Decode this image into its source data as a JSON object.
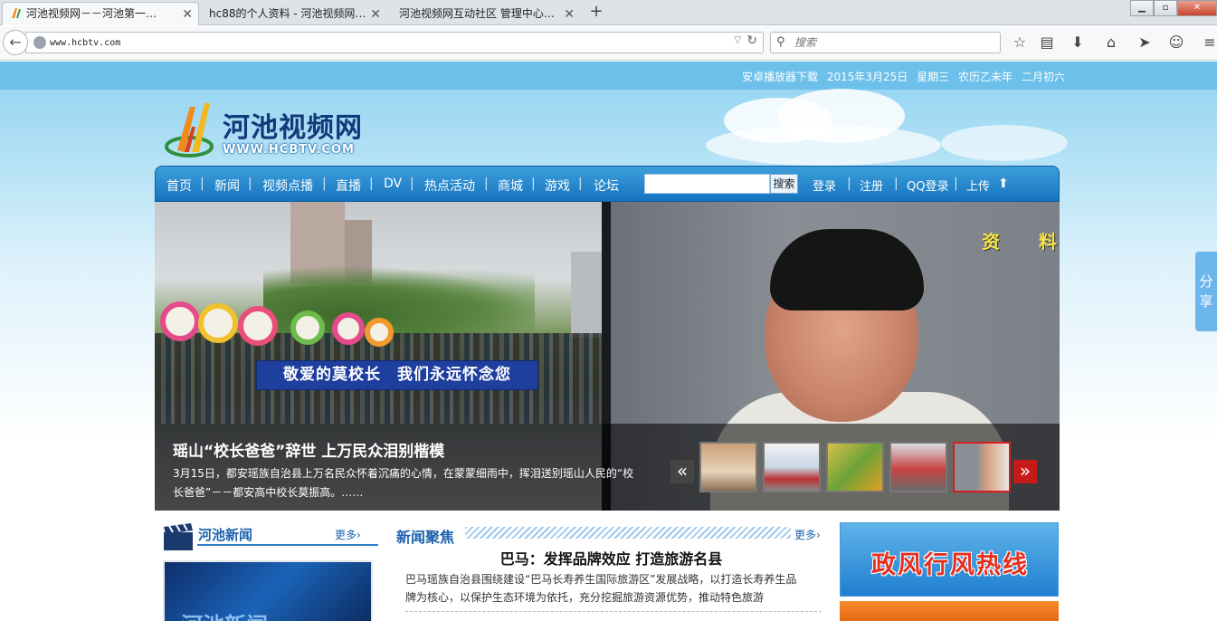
{
  "browser": {
    "tabs": [
      {
        "title": "河池视频网－－河池第一…",
        "active": true
      },
      {
        "title": "hc88的个人资料 - 河池视频网…",
        "active": false
      },
      {
        "title": "河池视频网互动社区 管理中心…",
        "active": false
      }
    ],
    "new_tab": "+",
    "url": "www.hcbtv.com",
    "search_placeholder": "搜索",
    "toolbar_icons": [
      "star-icon",
      "reading-list-icon",
      "download-icon",
      "home-icon",
      "send-icon",
      "chat-icon",
      "menu-icon"
    ]
  },
  "header": {
    "topbar_items": [
      "安卓播放器下载",
      "2015年3月25日",
      "星期三",
      "农历乙未年",
      "二月初六"
    ],
    "logo_text": "河池视频网",
    "logo_url_text": "WWW.HCBTV.COM"
  },
  "nav": {
    "items": [
      "首页",
      "新闻",
      "视频点播",
      "直播",
      "DV",
      "热点活动",
      "商城",
      "游戏",
      "论坛"
    ],
    "search_button": "搜索",
    "user_links": [
      "登录",
      "注册",
      "QQ登录",
      "上传"
    ]
  },
  "slider": {
    "banner_text": "敬爱的莫校长　我们永远怀念您",
    "overlay_text": "资 料",
    "title": "瑶山“校长爸爸”辞世 上万民众泪别楷模",
    "description": "3月15日，都安瑶族自治县上万名民众怀着沉痛的心情，在蒙蒙细雨中，挥泪送别瑶山人民的“校长爸爸”－－都安高中校长莫振高。……",
    "thumb_count": 5,
    "active_thumb": 5
  },
  "sections": {
    "hechi_news": {
      "title": "河池新闻",
      "more": "更多›",
      "thumb_text": "河池新闻"
    },
    "news_focus": {
      "title": "新闻聚焦",
      "more": "更多›",
      "headline": "巴马：发挥品牌效应  打造旅游名县",
      "summary": "巴马瑶族自治县围绕建设“巴马长寿养生国际旅游区”发展战略，以打造长寿养生品牌为核心，以保护生态环境为依托，充分挖掘旅游资源优势，推动特色旅游"
    },
    "ad_hotline": "政风行风热线"
  },
  "share_tab": "分享",
  "colors": {
    "nav_blue": "#1674bf",
    "accent_red": "#c51a1a",
    "link_blue": "#1b62ad"
  }
}
